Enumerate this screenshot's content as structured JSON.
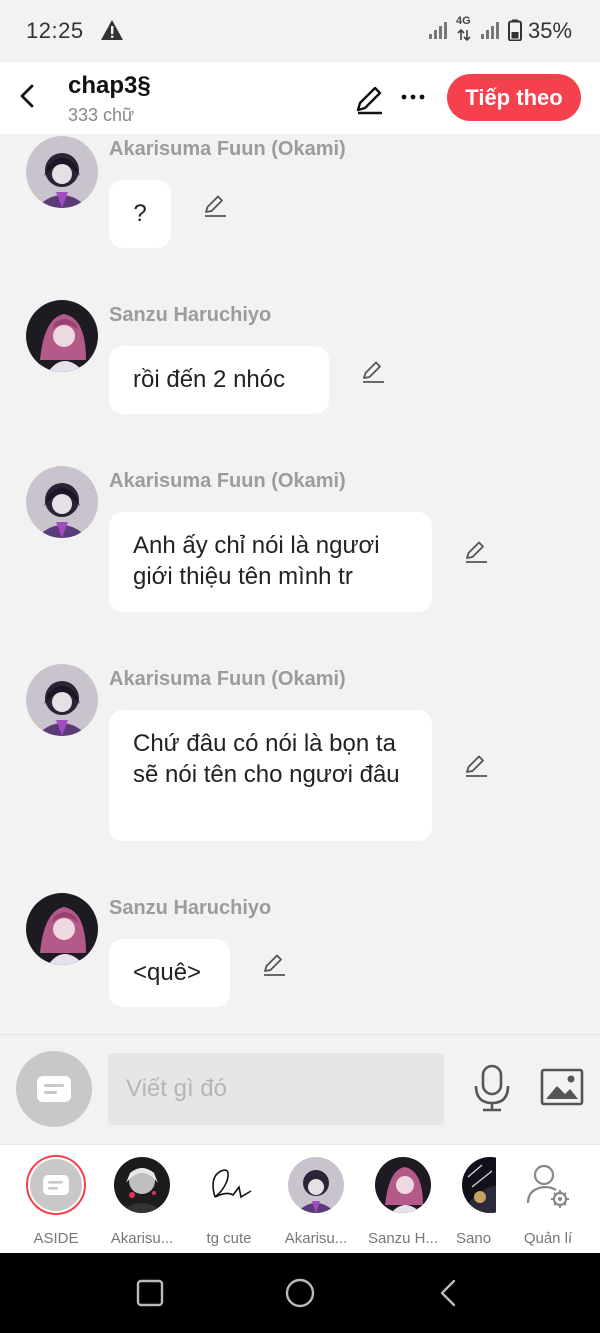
{
  "status_bar": {
    "time": "12:25",
    "network": "4G",
    "battery": "35%"
  },
  "header": {
    "title": "chap3§",
    "word_count": "333 chữ",
    "next_label": "Tiếp theo"
  },
  "messages": [
    {
      "sender": "Akarisuma Fuun (Okami)",
      "text": "?",
      "avatar": "akarisuma-avatar"
    },
    {
      "sender": "Sanzu Haruchiyo",
      "text": "rồi đến 2 nhóc",
      "avatar": "sanzu-avatar"
    },
    {
      "sender": "Akarisuma Fuun (Okami)",
      "text": "Anh ấy chỉ nói là ngươi giới thiệu tên mình tr",
      "avatar": "akarisuma-avatar"
    },
    {
      "sender": "Akarisuma Fuun (Okami)",
      "text": "Chứ đâu có nói là bọn ta sẽ nói tên cho ngươi đâu",
      "avatar": "akarisuma-avatar"
    },
    {
      "sender": "Sanzu Haruchiyo",
      "text": "<quê>",
      "avatar": "sanzu-avatar"
    }
  ],
  "composer": {
    "placeholder": "Viết gì đó"
  },
  "characters": [
    {
      "name": "ASIDE"
    },
    {
      "name": "Akarisu..."
    },
    {
      "name": "tg cute"
    },
    {
      "name": "Akarisu..."
    },
    {
      "name": "Sanzu H..."
    },
    {
      "name": "Sano"
    },
    {
      "name": "Quản lí"
    }
  ],
  "colors": {
    "accent": "#f5404d",
    "background": "#f2f2f2",
    "sender_name": "#9c9c9c"
  }
}
